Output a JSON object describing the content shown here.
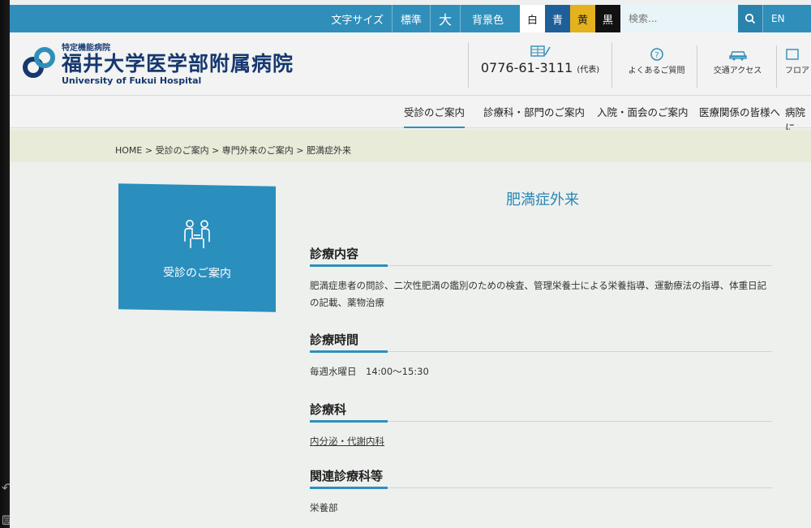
{
  "utility": {
    "font_size_label": "文字サイズ",
    "standard": "標準",
    "large": "大",
    "bg_color_label": "背景色",
    "white": "白",
    "blue": "青",
    "yellow": "黄",
    "black": "黒",
    "search_placeholder": "検索...",
    "lang": "EN"
  },
  "header": {
    "logo_small": "特定機能病院",
    "logo_name": "福井大学医学部附属病院",
    "logo_en": "University of Fukui Hospital",
    "tel": "0776-61-3111",
    "tel_note": "(代表)",
    "faq": "よくあるご質問",
    "access": "交通アクセス",
    "floor": "フロア"
  },
  "nav": [
    "受診のご案内",
    "診療科・部門のご案内",
    "入院・面会のご案内",
    "医療関係の皆様へ",
    "病院に"
  ],
  "breadcrumb": "HOME > 受診のご案内 > 専門外来のご案内 > 肥満症外来",
  "side_card": {
    "label": "受診のご案内"
  },
  "page_title": "肥満症外来",
  "sections": [
    {
      "heading": "診療内容",
      "body": "肥満症患者の問診、二次性肥満の鑑別のための検査、管理栄養士による栄養指導、運動療法の指導、体重日記の記載、薬物治療"
    },
    {
      "heading": "診療時間",
      "body": "毎週水曜日　14:00～15:30"
    },
    {
      "heading": "診療科",
      "body": "内分泌・代謝内科"
    },
    {
      "heading": "関連診療科等",
      "body": "栄養部"
    }
  ],
  "colors": {
    "accent": "#2f8fba",
    "brand_navy": "#16386f"
  }
}
